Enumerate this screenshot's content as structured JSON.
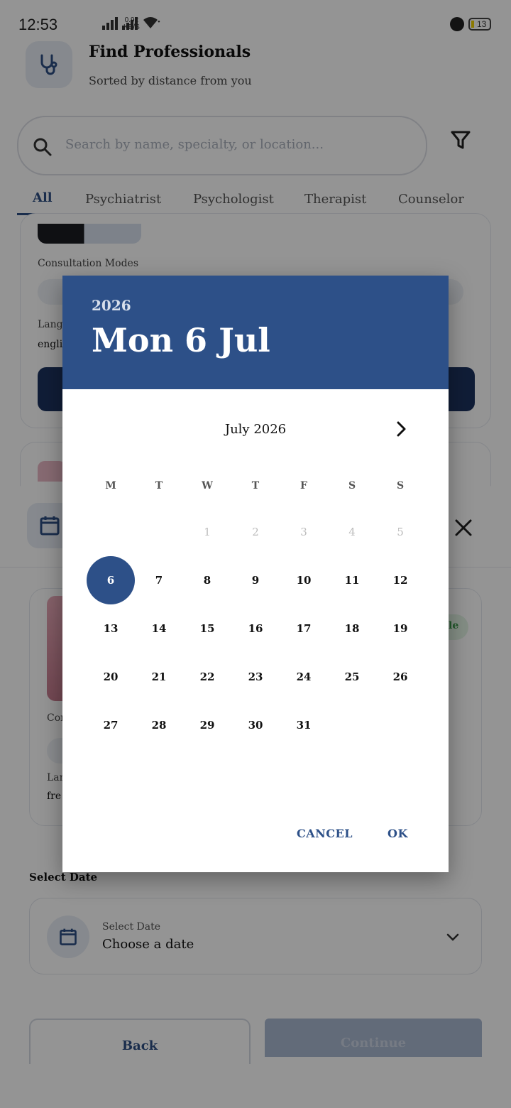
{
  "status_bar": {
    "time": "12:53",
    "net_speed_value": "0.92",
    "net_speed_unit": "KB/S",
    "dots": "···",
    "battery": "13"
  },
  "header": {
    "title": "Find Professionals",
    "subtitle": "Sorted by distance from you"
  },
  "search": {
    "placeholder": "Search by name, specialty, or location..."
  },
  "tabs": [
    {
      "label": "All"
    },
    {
      "label": "Psychiatrist"
    },
    {
      "label": "Psychologist"
    },
    {
      "label": "Therapist"
    },
    {
      "label": "Counselor"
    }
  ],
  "card1": {
    "consultation_label": "Consultation Modes",
    "language_label": "Langu",
    "language_value": "englis"
  },
  "sheet": {
    "card": {
      "consultation_label": "Con",
      "language_label": "Lan",
      "language_value": "fre",
      "badge_text": "le"
    },
    "select_date_title": "Select Date",
    "date_field": {
      "label": "Select Date",
      "value": "Choose a date"
    },
    "back_label": "Back",
    "continue_label": "Continue"
  },
  "date_picker": {
    "year": "2026",
    "selected_date": "Mon 6 Jul",
    "month_label": "July 2026",
    "weekdays": [
      "M",
      "T",
      "W",
      "T",
      "F",
      "S",
      "S"
    ],
    "disabled_days": [
      "1",
      "2",
      "3",
      "4",
      "5"
    ],
    "selected_day": "6",
    "days_row2": [
      "7",
      "8",
      "9",
      "10",
      "11",
      "12"
    ],
    "days_row3": [
      "13",
      "14",
      "15",
      "16",
      "17",
      "18",
      "19"
    ],
    "days_row4": [
      "20",
      "21",
      "22",
      "23",
      "24",
      "25",
      "26"
    ],
    "days_row5": [
      "27",
      "28",
      "29",
      "30",
      "31"
    ],
    "cancel_label": "CANCEL",
    "ok_label": "OK"
  },
  "colors": {
    "primary": "#2d5088",
    "scrim": "rgba(0,0,0,0.42)"
  },
  "icons": [
    "stethoscope-icon",
    "search-icon",
    "filter-icon",
    "calendar-icon",
    "close-icon",
    "chevron-down-icon",
    "chevron-right-icon",
    "alarm-icon",
    "battery-icon",
    "wifi-icon",
    "signal-icon"
  ]
}
